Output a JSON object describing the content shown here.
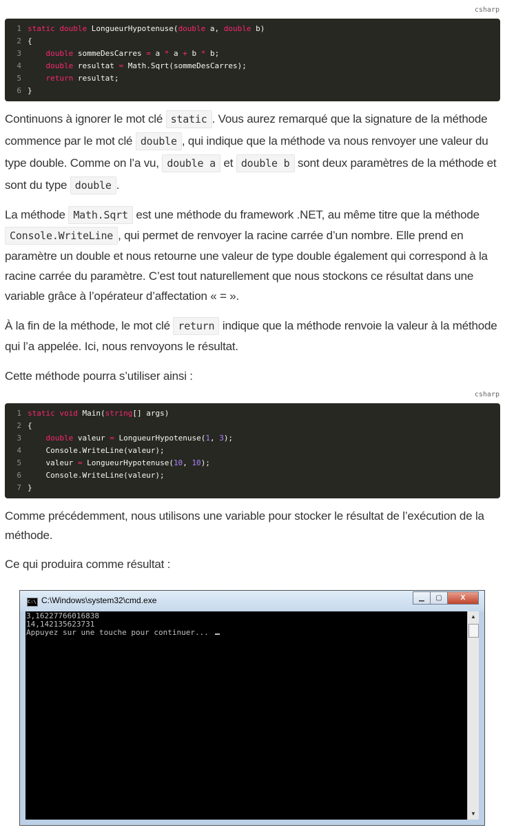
{
  "code_block_1": {
    "language": "csharp",
    "lines": [
      {
        "n": "1",
        "parts": [
          [
            "kw",
            "static double "
          ],
          [
            "t",
            "LongueurHypotenuse("
          ],
          [
            "kw",
            "double"
          ],
          [
            "t",
            " a, "
          ],
          [
            "kw",
            "double"
          ],
          [
            "t",
            " b)"
          ]
        ]
      },
      {
        "n": "2",
        "parts": [
          [
            "t",
            "{"
          ]
        ]
      },
      {
        "n": "3",
        "parts": [
          [
            "t",
            "    "
          ],
          [
            "kw",
            "double"
          ],
          [
            "t",
            " sommeDesCarres "
          ],
          [
            "kw",
            "="
          ],
          [
            "t",
            " a "
          ],
          [
            "kw",
            "*"
          ],
          [
            "t",
            " a "
          ],
          [
            "kw",
            "+"
          ],
          [
            "t",
            " b "
          ],
          [
            "kw",
            "*"
          ],
          [
            "t",
            " b;"
          ]
        ]
      },
      {
        "n": "4",
        "parts": [
          [
            "t",
            "    "
          ],
          [
            "kw",
            "double"
          ],
          [
            "t",
            " resultat "
          ],
          [
            "kw",
            "="
          ],
          [
            "t",
            " Math.Sqrt(sommeDesCarres);"
          ]
        ]
      },
      {
        "n": "5",
        "parts": [
          [
            "t",
            "    "
          ],
          [
            "kw",
            "return"
          ],
          [
            "t",
            " resultat;"
          ]
        ]
      },
      {
        "n": "6",
        "parts": [
          [
            "t",
            "}"
          ]
        ]
      }
    ]
  },
  "para1": {
    "t1": "Continuons à ignorer le mot clé ",
    "c1": "static",
    "t2": ". Vous aurez remarqué que la signature de la méthode commence par le mot clé ",
    "c2": "double",
    "t3": ", qui indique que la méthode va nous renvoyer une valeur du type double. Comme on l’a vu, ",
    "c3": "double a",
    "t4": " et ",
    "c4": "double b",
    "t5": " sont deux paramètres de la méthode et sont du type ",
    "c5": "double",
    "t6": "."
  },
  "para2": {
    "t1": "La méthode ",
    "c1": "Math.Sqrt",
    "t2": " est une méthode du framework .NET, au même titre que la méthode ",
    "c2": "Console.WriteLine",
    "t3": ", qui permet de renvoyer la racine carrée d’un nombre. Elle prend en paramètre un double et nous retourne une valeur de type double également qui correspond à la racine carrée du paramètre. C’est tout naturellement que nous stockons ce résultat dans une variable grâce à l’opérateur d’affectation « = »."
  },
  "para3": {
    "t1": "À la fin de la méthode, le mot clé ",
    "c1": "return",
    "t2": " indique que la méthode renvoie la valeur à la méthode qui l’a appelée. Ici, nous renvoyons le résultat."
  },
  "para4": "Cette méthode pourra s’utiliser ainsi :",
  "code_block_2": {
    "language": "csharp",
    "lines": [
      {
        "n": "1",
        "parts": [
          [
            "kw",
            "static void "
          ],
          [
            "t",
            "Main("
          ],
          [
            "kw",
            "string"
          ],
          [
            "t",
            "[] args)"
          ]
        ]
      },
      {
        "n": "2",
        "parts": [
          [
            "t",
            "{"
          ]
        ]
      },
      {
        "n": "3",
        "parts": [
          [
            "t",
            "    "
          ],
          [
            "kw",
            "double"
          ],
          [
            "t",
            " valeur "
          ],
          [
            "kw",
            "="
          ],
          [
            "t",
            " LongueurHypotenuse("
          ],
          [
            "num",
            "1"
          ],
          [
            "t",
            ", "
          ],
          [
            "num",
            "3"
          ],
          [
            "t",
            ");"
          ]
        ]
      },
      {
        "n": "4",
        "parts": [
          [
            "t",
            "    Console.WriteLine(valeur);"
          ]
        ]
      },
      {
        "n": "5",
        "parts": [
          [
            "t",
            "    valeur "
          ],
          [
            "kw",
            "="
          ],
          [
            "t",
            " LongueurHypotenuse("
          ],
          [
            "num",
            "10"
          ],
          [
            "t",
            ", "
          ],
          [
            "num",
            "10"
          ],
          [
            "t",
            ");"
          ]
        ]
      },
      {
        "n": "6",
        "parts": [
          [
            "t",
            "    Console.WriteLine(valeur);"
          ]
        ]
      },
      {
        "n": "7",
        "parts": [
          [
            "t",
            "}"
          ]
        ]
      }
    ]
  },
  "para5": "Comme précédemment, nous utilisons une variable pour stocker le résultat de l’exécution de la méthode.",
  "para6": "Ce qui produira comme résultat :",
  "cmd_window": {
    "title": "C:\\Windows\\system32\\cmd.exe",
    "icon_text": "C:\\",
    "minimize_icon": "minimize-icon",
    "maximize_icon": "maximize-icon",
    "close_label": "X",
    "output": [
      "3,16227766016838",
      "14,142135623731",
      "Appuyez sur une touche pour continuer... "
    ]
  }
}
